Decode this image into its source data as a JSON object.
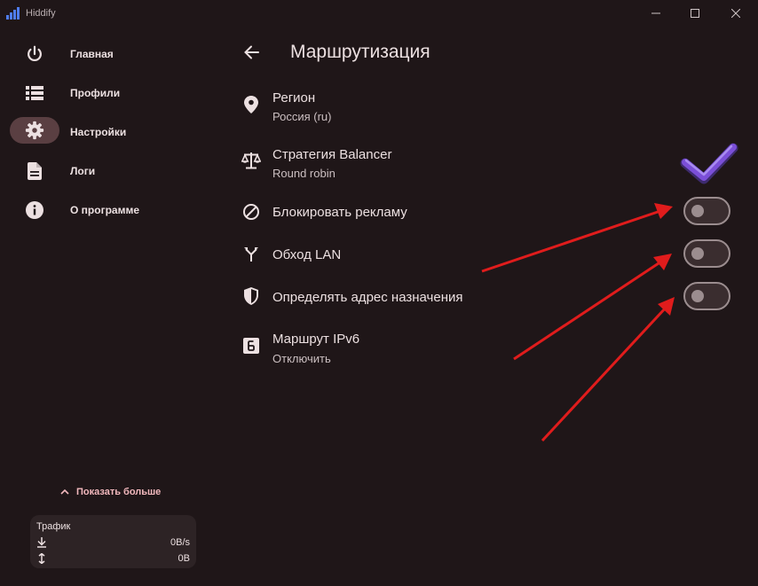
{
  "window": {
    "title": "Hiddify"
  },
  "sidebar": {
    "items": [
      {
        "label": "Главная",
        "icon": "power-icon",
        "active": false
      },
      {
        "label": "Профили",
        "icon": "list-icon",
        "active": false
      },
      {
        "label": "Настройки",
        "icon": "gear-icon",
        "active": true
      },
      {
        "label": "Логи",
        "icon": "document-icon",
        "active": false
      },
      {
        "label": "О программе",
        "icon": "info-icon",
        "active": false
      }
    ],
    "show_more": "Показать больше",
    "traffic": {
      "title": "Трафик",
      "speed": "0B/s",
      "total": "0B"
    }
  },
  "page": {
    "title": "Маршрутизация",
    "settings": [
      {
        "title": "Регион",
        "subtitle": "Россия (ru)",
        "icon": "location-pin-icon"
      },
      {
        "title": "Стратегия Balancer",
        "subtitle": "Round robin",
        "icon": "balance-scale-icon"
      },
      {
        "title": "Блокировать рекламу",
        "icon": "block-icon",
        "toggle": false
      },
      {
        "title": "Обход LAN",
        "icon": "fork-icon",
        "toggle": false
      },
      {
        "title": "Определять адрес назначения",
        "icon": "shield-icon",
        "toggle": false
      },
      {
        "title": "Маршрут IPv6",
        "subtitle": "Отключить",
        "icon": "ipv6-badge-icon"
      }
    ]
  },
  "colors": {
    "background": "#1f1618",
    "active_nav": "#5a3f42",
    "accent": "#f2b8bd",
    "annotation_arrow": "#e01c1c",
    "checkmark": "#7b4fd8"
  }
}
